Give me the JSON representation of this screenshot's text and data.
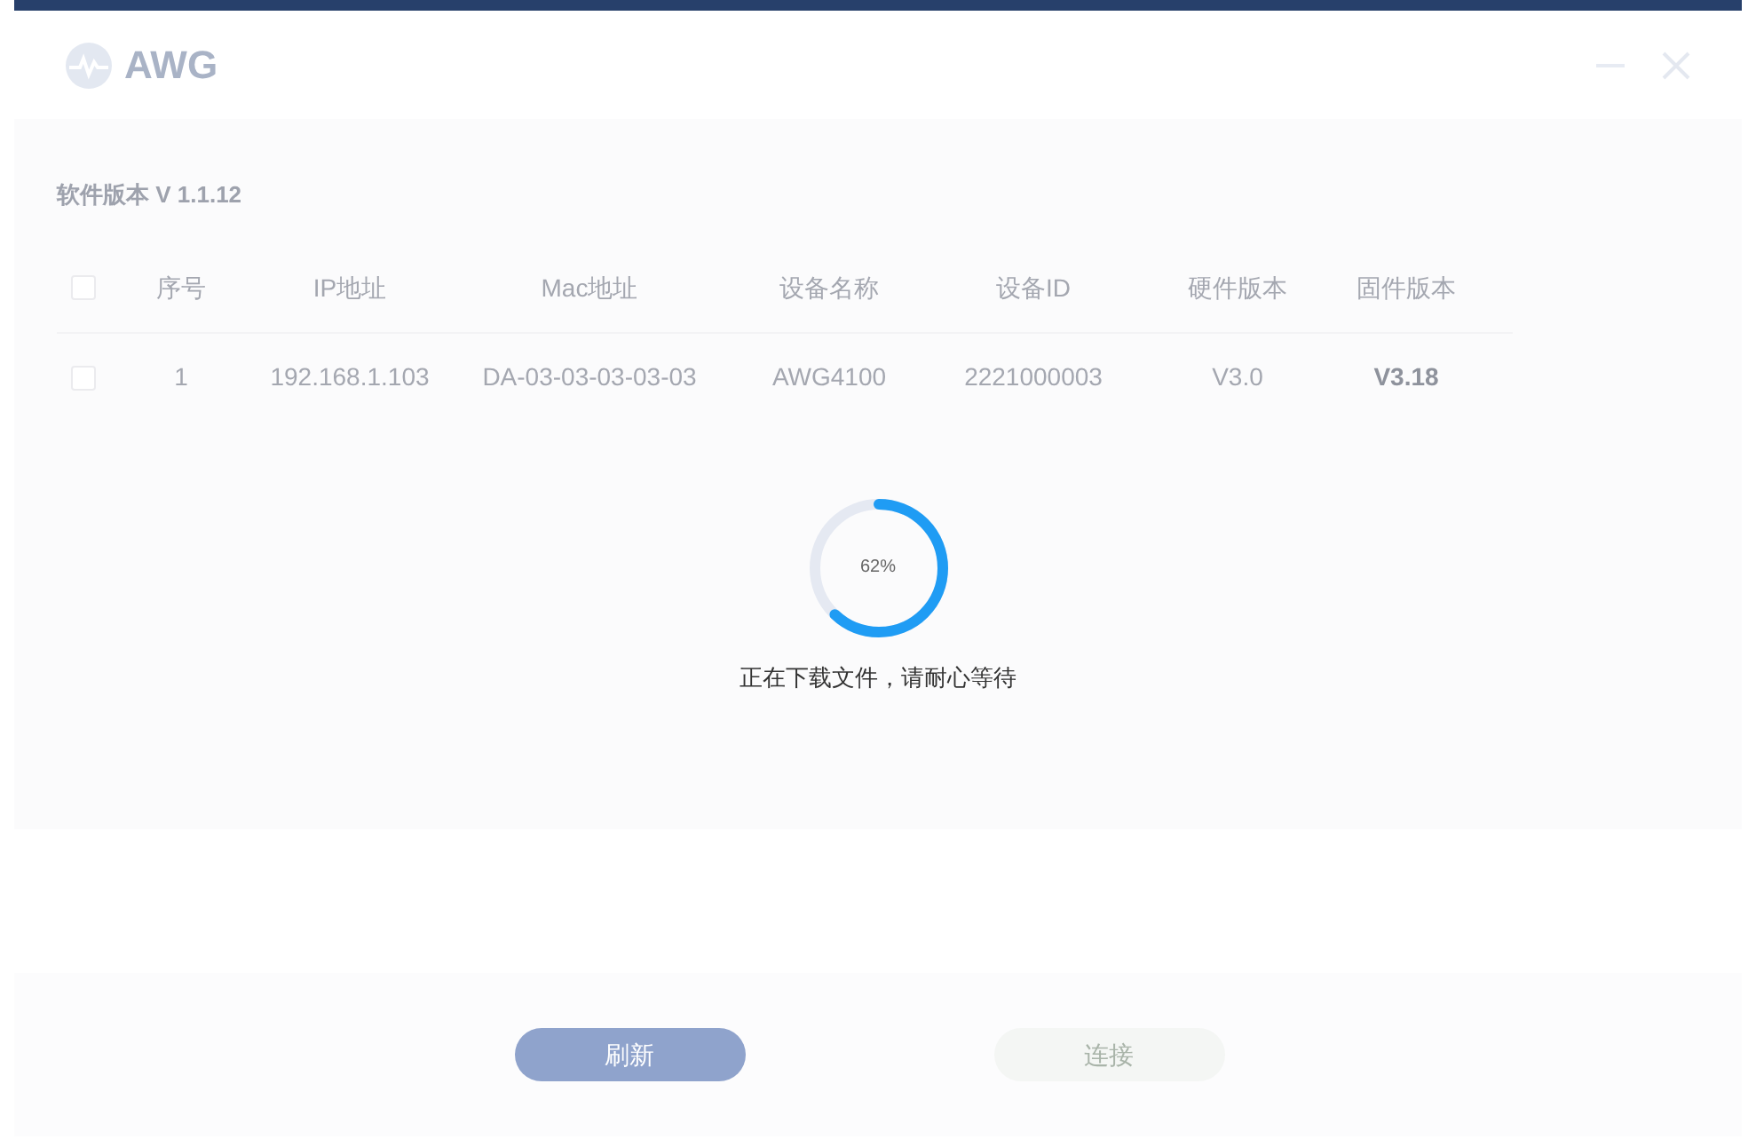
{
  "window": {
    "title": "AWG"
  },
  "software_version": "软件版本 V 1.1.12",
  "table": {
    "header_checkbox": {
      "checked": false
    },
    "columns": [
      "序号",
      "IP地址",
      "Mac地址",
      "设备名称",
      "设备ID",
      "硬件版本",
      "固件版本"
    ],
    "rows": [
      {
        "checked": false,
        "cells": [
          "1",
          "192.168.1.103",
          "DA-03-03-03-03-03",
          "AWG4100",
          "2221000003",
          "V3.0",
          "V3.18"
        ]
      }
    ]
  },
  "progress": {
    "level": 0.62,
    "reading": "62%",
    "message": "正在下载文件，请耐心等待"
  },
  "buttons": [
    {
      "label": "刷新",
      "disabled": false
    },
    {
      "label": "连接",
      "disabled": true
    }
  ]
}
